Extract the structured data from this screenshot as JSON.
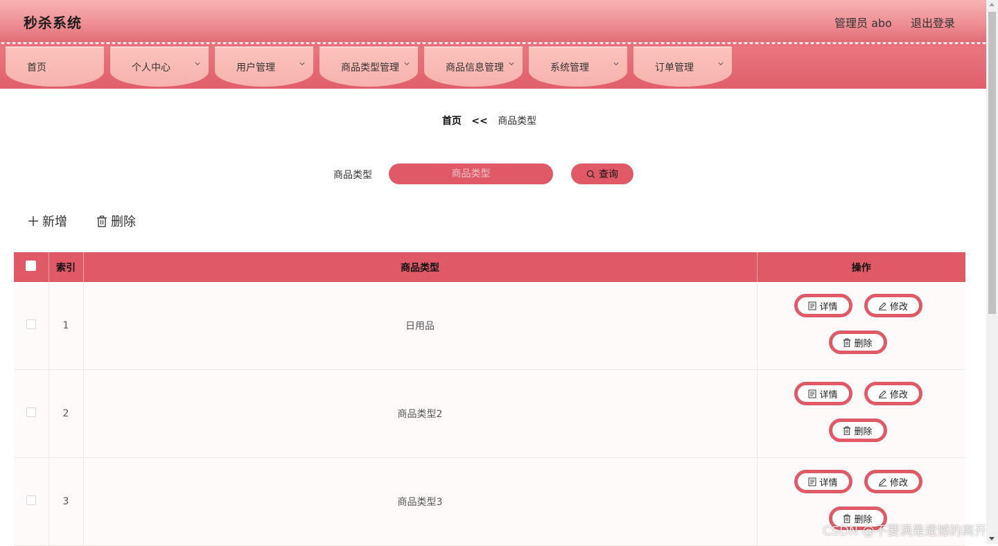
{
  "header": {
    "app_title": "秒杀系统",
    "user_label": "管理员 abo",
    "logout_label": "退出登录"
  },
  "nav": {
    "items": [
      {
        "label": "首页",
        "has_dropdown": false
      },
      {
        "label": "个人中心",
        "has_dropdown": true
      },
      {
        "label": "用户管理",
        "has_dropdown": true
      },
      {
        "label": "商品类型管理",
        "has_dropdown": true
      },
      {
        "label": "商品信息管理",
        "has_dropdown": true
      },
      {
        "label": "系统管理",
        "has_dropdown": true
      },
      {
        "label": "订单管理",
        "has_dropdown": true
      }
    ]
  },
  "breadcrumb": {
    "home": "首页",
    "separator": "<<",
    "current": "商品类型"
  },
  "search": {
    "label": "商品类型",
    "placeholder": "商品类型",
    "value": "",
    "button_label": "查询"
  },
  "toolbar": {
    "add_label": "新增",
    "delete_label": "删除"
  },
  "table": {
    "columns": [
      "",
      "索引",
      "商品类型",
      "操作"
    ],
    "rows": [
      {
        "index": "1",
        "type": "日用品"
      },
      {
        "index": "2",
        "type": "商品类型2"
      },
      {
        "index": "3",
        "type": "商品类型3"
      }
    ],
    "row_actions": {
      "detail": "详情",
      "edit": "修改",
      "delete": "删除"
    }
  },
  "watermark": "CSDN @不要满是遗憾的离开",
  "colors": {
    "accent": "#df5967",
    "nav_tab": "#f8b2ad",
    "header_top": "#f8b3b3"
  }
}
